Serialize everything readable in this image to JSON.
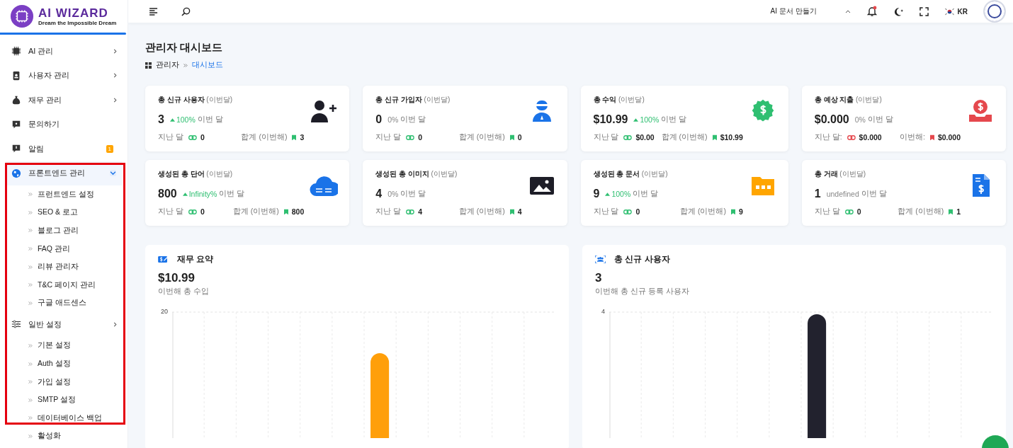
{
  "brand": {
    "name": "AI WIZARD",
    "tagline": "Dream the Impossible Dream"
  },
  "sidebar": {
    "items": [
      {
        "label": "AI 관리",
        "kind": "chip",
        "expanded": false,
        "selected": false
      },
      {
        "label": "사용자 관리",
        "kind": "badge",
        "expanded": false,
        "selected": false
      },
      {
        "label": "재무 관리",
        "kind": "moneybag",
        "expanded": false,
        "selected": false
      },
      {
        "label": "문의하기",
        "kind": "question",
        "selected": false
      },
      {
        "label": "알림",
        "kind": "alert",
        "selected": false,
        "badge": "1"
      },
      {
        "label": "프론트엔드 관리",
        "kind": "globe",
        "expanded": true,
        "selected": true,
        "children": [
          {
            "label": "프런트엔드 설정"
          },
          {
            "label": "SEO & 로고"
          },
          {
            "label": "블로그 관리"
          },
          {
            "label": "FAQ 관리"
          },
          {
            "label": "리뷰 관리자"
          },
          {
            "label": "T&C 페이지 관리"
          },
          {
            "label": "구글 애드센스"
          }
        ]
      },
      {
        "label": "일반 설정",
        "kind": "sliders",
        "expanded": false,
        "selected": false,
        "children": [
          {
            "label": "기본 설정"
          },
          {
            "label": "Auth 설정"
          },
          {
            "label": "가입 설정"
          },
          {
            "label": "SMTP 설정"
          },
          {
            "label": "데이터베이스 백업"
          },
          {
            "label": "활성화"
          }
        ]
      }
    ]
  },
  "header": {
    "create_menu": "AI 문서 만들기",
    "notification_unread": true,
    "language": "KR"
  },
  "page": {
    "title": "관리자 대시보드",
    "breadcrumb": [
      {
        "label": "관리자",
        "current": false
      },
      {
        "label": "대시보드",
        "current": true
      }
    ]
  },
  "stats": [
    {
      "title": "총 신규 사용자",
      "period": "(이번달)",
      "value": "3",
      "rising": true,
      "change": "100%",
      "change_label": "이번 달",
      "last_label": "지난 달",
      "last_value": "0",
      "total_label": "합계 (이번해)",
      "total_value": "3",
      "kind": "user-plus",
      "color": "#2fbf71"
    },
    {
      "title": "총 신규 가입자",
      "period": "(이번달)",
      "value": "0",
      "rising": false,
      "change": "0%",
      "change_label": "이번 달",
      "last_label": "지난 달",
      "last_value": "0",
      "total_label": "합계 (이번해)",
      "total_value": "0",
      "kind": "user-badge",
      "color": "#2fbf71"
    },
    {
      "title": "총 수익",
      "period": "(이번달)",
      "value": "$10.99",
      "rising": true,
      "change": "100%",
      "change_label": "이번 달",
      "last_label": "지난 달",
      "last_value": "$0.00",
      "total_label": "합계 (이번해)",
      "total_value": "$10.99",
      "kind": "dollar-seal",
      "color": "#2fbf71"
    },
    {
      "title": "총 예상 지출",
      "period": "(이번달)",
      "value": "$0.000",
      "rising": false,
      "change": "0%",
      "change_label": "이번 달",
      "last_label": "지난 달:",
      "last_value": "$0.000",
      "total_label": "이번해:",
      "total_value": "$0.000",
      "kind": "dollar-tray",
      "color": "#e5484d"
    },
    {
      "title": "생성된 총 단어",
      "period": "(이번달)",
      "value": "800",
      "rising": true,
      "change": "Infinity%",
      "change_label": "이번 달",
      "last_label": "지난 달",
      "last_value": "0",
      "total_label": "합계 (이번해)",
      "total_value": "800",
      "kind": "cloud",
      "color": "#2fbf71"
    },
    {
      "title": "생성된 총 이미지",
      "period": "(이번달)",
      "value": "4",
      "rising": false,
      "change": "0%",
      "change_label": "이번 달",
      "last_label": "지난 달",
      "last_value": "4",
      "total_label": "합계 (이번해)",
      "total_value": "4",
      "kind": "image",
      "color": "#2fbf71"
    },
    {
      "title": "생성된 총 문서",
      "period": "(이번달)",
      "value": "9",
      "rising": true,
      "change": "100%",
      "change_label": "이번 달",
      "last_label": "지난 달",
      "last_value": "0",
      "total_label": "합계 (이번해)",
      "total_value": "9",
      "kind": "folder",
      "color": "#2fbf71"
    },
    {
      "title": "총 거래",
      "period": "(이번달)",
      "value": "1",
      "rising": false,
      "change": "undefined",
      "change_label": "이번 달",
      "last_label": "지난 달",
      "last_value": "0",
      "total_label": "합계 (이번해)",
      "total_value": "1",
      "kind": "invoice",
      "color": "#2fbf71"
    }
  ],
  "charts": [
    {
      "title": "재무 요약",
      "kind": "money",
      "value": "$10.99",
      "caption": "이번해 총 수입",
      "top_tick": "20"
    },
    {
      "title": "총 신규 사용자",
      "kind": "users",
      "value": "3",
      "caption": "이번해 총 신규 등록 사용자",
      "top_tick": "4"
    }
  ]
}
